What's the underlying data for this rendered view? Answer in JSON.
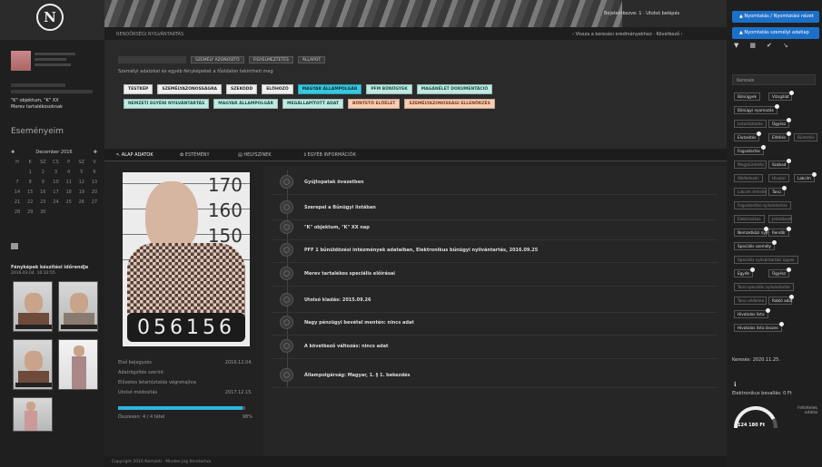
{
  "header": {
    "logo_letter": "N",
    "system_name": "RENDŐRSÉGI NYILVÁNTARTÁS",
    "user_line": "Bejelentkezve: 1 · Utolsó belépés",
    "help_line": "‹ Vissza a keresési eredményekhez · Következő ›"
  },
  "left": {
    "incident_lines": [
      "\"K\" objektum, \"K\" XX",
      "Merev tartalékosoknak"
    ],
    "calendar_title": "Eseményeim",
    "calendar_month": "December 2016",
    "calendar_rows": [
      [
        "H",
        "K",
        "SZ",
        "CS",
        "P",
        "SZ",
        "V"
      ],
      [
        "",
        "1",
        "2",
        "3",
        "4",
        "5",
        "6"
      ],
      [
        "7",
        "8",
        "9",
        "10",
        "11",
        "12",
        "13"
      ],
      [
        "14",
        "15",
        "16",
        "17",
        "18",
        "19",
        "20"
      ],
      [
        "21",
        "22",
        "23",
        "24",
        "25",
        "26",
        "27"
      ],
      [
        "28",
        "29",
        "30",
        "",
        "",
        "",
        ""
      ]
    ],
    "photos_title": "Fényképek készítési időrendje",
    "photos_date": "2016.03.04. 10:32:55"
  },
  "info": {
    "chips": [
      "SZEMÉLY AZONOSÍTÓ",
      "FIGYELMEZTETÉS",
      "ÁLLAPOT"
    ],
    "info_line": "Személyi adatokat és egyéb fényképeket a főoldalon tekintheti meg",
    "tags_row1": [
      {
        "label": "TESTKÉP",
        "style": "white"
      },
      {
        "label": "SZEMÉLYAZONOSSÁGRA",
        "style": "white"
      },
      {
        "label": "SZEKÓDD",
        "style": "white"
      },
      {
        "label": "ELŐHOZÓ",
        "style": "white"
      },
      {
        "label": "MAGYAR ÁLLAMPOLGÁR",
        "style": "cyan"
      },
      {
        "label": "PFM BŰNÜGYEK",
        "style": "mint"
      },
      {
        "label": "MAGÁNÉLET DOKUMENTÁCIÓ",
        "style": "mint"
      }
    ],
    "tags_row2": [
      {
        "label": "NEMZETI EGYÉNI NYILVÁNTARTÁS",
        "style": "mint"
      },
      {
        "label": "MAGYAR ÁLLAMPOLGÁR",
        "style": "mint"
      },
      {
        "label": "MEGÁLLAPÍTOTT ADAT",
        "style": "mint"
      },
      {
        "label": "BŰNTETŐ ELŐÉLET",
        "style": "peach"
      },
      {
        "label": "SZEMÉLYAZONOSSÁGI ELLENŐRZÉS",
        "style": "peach"
      }
    ]
  },
  "tabs": [
    "ALAP ADATOK",
    "ESTÉMÉNY",
    "HELYSZÍNEK",
    "EGYÉB INFORMÁCIÓK"
  ],
  "mugshot": {
    "rulers": [
      "170",
      "160",
      "150"
    ],
    "plate": "056156"
  },
  "meta": {
    "rows": [
      {
        "label": "Első bejegyzés",
        "value": "2016.12.04."
      },
      {
        "label": "Adatrögzítés szerint",
        "value": ""
      },
      {
        "label": "Előzetes letartóztatás végrehajtva",
        "value": ""
      },
      {
        "label": "Utolsó módosítás",
        "value": "2017.12.15."
      }
    ],
    "progress_percent": 98,
    "progress_left": "Összesen: 4 / 4 tétel",
    "progress_right": "98%"
  },
  "timeline": {
    "items": [
      {
        "icon": "◯",
        "text": "Gyújtopatak övezetben"
      },
      {
        "icon": "◯",
        "text": "Szerepel a Bűnügyi listában"
      },
      {
        "icon": "◯",
        "text": "\"K\" objektum, \"K\" XX nap"
      },
      {
        "icon": "◯",
        "text": "PFF 1 bűnüldözési intézmények adataiban, Elektronikus bűnügyi nyilvántartás, 2016.09.25"
      },
      {
        "icon": "◯",
        "text": "Merev tartalékos speciális előírásai"
      },
      {
        "icon": "◯",
        "text": "Utolsó kiadás: 2015.09.26"
      },
      {
        "icon": "◯",
        "text": "Nagy pénzügyi bevétel mentén: nincs adat"
      },
      {
        "icon": "◯",
        "text": "A következő változás: nincs adat"
      },
      {
        "icon": "◯",
        "text": "Állampolgárság: Magyar, 1. § 1. bekezdés"
      }
    ]
  },
  "footer": "Copyright 2016 Nemzeti · Minden jog fenntartva",
  "right": {
    "btn1": "▲ Nyomtatás / Nyomtatási nézet",
    "btn2": "▲ Nyomtatás személyi adatlap",
    "icons": [
      "▼",
      "▦",
      "✔",
      "↘"
    ],
    "search_placeholder": "Keresés",
    "tags": [
      {
        "label": "Bűnügyek",
        "dim": false,
        "badge": false,
        "row": 0,
        "col": 0
      },
      {
        "label": "Vizsgálat",
        "dim": false,
        "badge": true,
        "row": 0,
        "col": 1
      },
      {
        "label": "Bűnügyi nyomozás",
        "dim": false,
        "badge": true,
        "row": 1,
        "col": 0
      },
      {
        "label": "Letartóztatás",
        "dim": true,
        "badge": false,
        "row": 2,
        "col": 0
      },
      {
        "label": "Ügyész",
        "dim": false,
        "badge": true,
        "row": 2,
        "col": 1
      },
      {
        "label": "Elutasítás",
        "dim": false,
        "badge": true,
        "row": 3,
        "col": 0
      },
      {
        "label": "Elítélés",
        "dim": false,
        "badge": true,
        "row": 3,
        "col": 1
      },
      {
        "label": "Büntetés",
        "dim": true,
        "badge": false,
        "row": 3,
        "col": 2
      },
      {
        "label": "Fogvatartás",
        "dim": false,
        "badge": true,
        "row": 4,
        "col": 0
      },
      {
        "label": "Megszüntetés hivatalból",
        "dim": true,
        "badge": false,
        "row": 5,
        "col": 0
      },
      {
        "label": "Szabad",
        "dim": false,
        "badge": true,
        "row": 5,
        "col": 1
      },
      {
        "label": "Áttételezés",
        "dim": true,
        "badge": false,
        "row": 6,
        "col": 0
      },
      {
        "label": "Hivatal",
        "dim": true,
        "badge": false,
        "row": 6,
        "col": 1
      },
      {
        "label": "Lakcím",
        "dim": false,
        "badge": true,
        "row": 6,
        "col": 2
      },
      {
        "label": "Lakcím értesítés",
        "dim": true,
        "badge": false,
        "row": 7,
        "col": 0
      },
      {
        "label": "Tanú",
        "dim": false,
        "badge": true,
        "row": 7,
        "col": 1
      },
      {
        "label": "Fogvatartási nyilvántartás",
        "dim": true,
        "badge": false,
        "row": 8,
        "col": 0
      },
      {
        "label": "Elektronikus",
        "dim": true,
        "badge": false,
        "row": 9,
        "col": 0
      },
      {
        "label": "Jelentkezés",
        "dim": true,
        "badge": false,
        "row": 9,
        "col": 1
      },
      {
        "label": "Nemzetközi nyilvántartás",
        "dim": false,
        "badge": true,
        "row": 10,
        "col": 0
      },
      {
        "label": "Rendőr",
        "dim": false,
        "badge": true,
        "row": 10,
        "col": 1
      },
      {
        "label": "Speciális személy",
        "dim": false,
        "badge": true,
        "row": 11,
        "col": 0
      },
      {
        "label": "Speciális nyilvántartási ügyek",
        "dim": true,
        "badge": false,
        "row": 12,
        "col": 0
      },
      {
        "label": "Egyéb",
        "dim": false,
        "badge": true,
        "row": 13,
        "col": 0
      },
      {
        "label": "Ügyész",
        "dim": false,
        "badge": true,
        "row": 13,
        "col": 1
      },
      {
        "label": "Tanú speciális nyilvántartás",
        "dim": true,
        "badge": false,
        "row": 14,
        "col": 0
      },
      {
        "label": "Tanú védelme",
        "dim": true,
        "badge": false,
        "row": 15,
        "col": 0
      },
      {
        "label": "Rabló adat",
        "dim": false,
        "badge": true,
        "row": 15,
        "col": 1
      },
      {
        "label": "Hivatalos lista",
        "dim": false,
        "badge": true,
        "row": 16,
        "col": 0
      },
      {
        "label": "Hivatalos lista összes",
        "dim": false,
        "badge": true,
        "row": 17,
        "col": 0
      }
    ],
    "year": "Keresés: 2020.11.25.",
    "info_icon": "ℹ",
    "count_text": "Elektronikus bevallás: 0 Ft",
    "gauge_value": "124 180 Ft",
    "gauge_fraction": 0.85,
    "paper_text": "Feltételek adatai"
  }
}
